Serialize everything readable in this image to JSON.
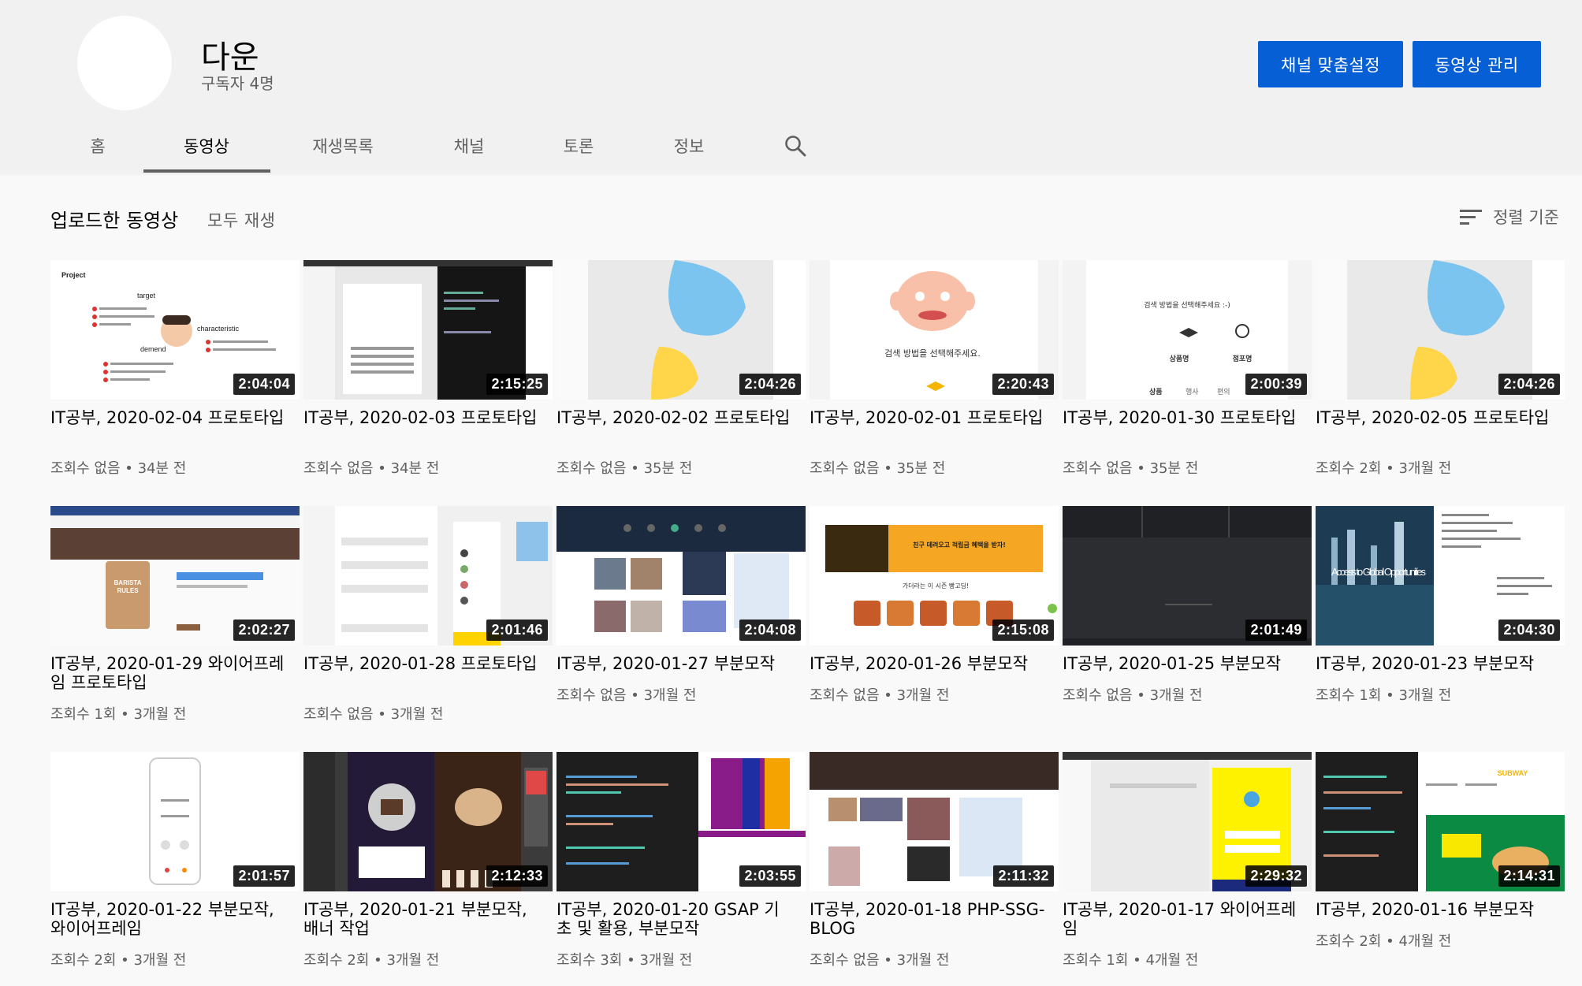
{
  "channel": {
    "name": "다운",
    "subscribers": "구독자 4명",
    "customize_label": "채널 맞춤설정",
    "manage_label": "동영상 관리"
  },
  "tabs": [
    {
      "label": "홈"
    },
    {
      "label": "동영상"
    },
    {
      "label": "재생목록"
    },
    {
      "label": "채널"
    },
    {
      "label": "토론"
    },
    {
      "label": "정보"
    }
  ],
  "section": {
    "title": "업로드한 동영상",
    "play_all": "모두 재생",
    "sort_label": "정렬 기준"
  },
  "videos": [
    {
      "title": "IT공부, 2020-02-04 프로토타입",
      "meta": "조회수 없음 • 34분 전",
      "duration": "2:04:04"
    },
    {
      "title": "IT공부, 2020-02-03 프로토타입",
      "meta": "조회수 없음 • 34분 전",
      "duration": "2:15:25"
    },
    {
      "title": "IT공부, 2020-02-02 프로토타입",
      "meta": "조회수 없음 • 35분 전",
      "duration": "2:04:26"
    },
    {
      "title": "IT공부, 2020-02-01 프로토타입",
      "meta": "조회수 없음 • 35분 전",
      "duration": "2:20:43"
    },
    {
      "title": "IT공부, 2020-01-30 프로토타입",
      "meta": "조회수 없음 • 35분 전",
      "duration": "2:00:39"
    },
    {
      "title": "IT공부, 2020-02-05 프로토타입",
      "meta": "조회수 2회 • 3개월 전",
      "duration": "2:04:26"
    },
    {
      "title": "IT공부, 2020-01-29 와이어프레임 프로토타입",
      "meta": "조회수 1회 • 3개월 전",
      "duration": "2:02:27"
    },
    {
      "title": "IT공부, 2020-01-28 프로토타입",
      "meta": "조회수 없음 • 3개월 전",
      "duration": "2:01:46"
    },
    {
      "title": "IT공부, 2020-01-27 부분모작",
      "meta": "조회수 없음 • 3개월 전",
      "duration": "2:04:08"
    },
    {
      "title": "IT공부, 2020-01-26 부분모작",
      "meta": "조회수 없음 • 3개월 전",
      "duration": "2:15:08"
    },
    {
      "title": "IT공부, 2020-01-25 부분모작",
      "meta": "조회수 없음 • 3개월 전",
      "duration": "2:01:49"
    },
    {
      "title": "IT공부, 2020-01-23 부분모작",
      "meta": "조회수 1회 • 3개월 전",
      "duration": "2:04:30"
    },
    {
      "title": "IT공부, 2020-01-22 부분모작, 와이어프레임",
      "meta": "조회수 2회 • 3개월 전",
      "duration": "2:01:57"
    },
    {
      "title": "IT공부, 2020-01-21 부분모작, 배너 작업",
      "meta": "조회수 2회 • 3개월 전",
      "duration": "2:12:33"
    },
    {
      "title": "IT공부, 2020-01-20 GSAP 기초 및 활용, 부분모작",
      "meta": "조회수 3회 • 3개월 전",
      "duration": "2:03:55"
    },
    {
      "title": "IT공부, 2020-01-18 PHP-SSG-BLOG",
      "meta": "조회수 없음 • 3개월 전",
      "duration": "2:11:32"
    },
    {
      "title": "IT공부, 2020-01-17 와이어프레임",
      "meta": "조회수 1회 • 4개월 전",
      "duration": "2:29:32"
    },
    {
      "title": "IT공부, 2020-01-16 부분모작",
      "meta": "조회수 2회 • 4개월 전",
      "duration": "2:14:31"
    }
  ],
  "thumb_text": {
    "t0_project": "Project",
    "t0_target": "target",
    "t0_characteristic": "characteristic",
    "t0_demend": "demend",
    "t3_caption": "검색 방법을 선택해주세요.",
    "t4_caption": "검색 방법을 선택해주세요 :-)",
    "t4_opt1": "상품명",
    "t4_opt2": "점포명",
    "t4_nav1": "상품",
    "t4_nav2": "행사",
    "t4_nav3": "편의",
    "t6_cup1": "BARISTA",
    "t6_cup2": "RULES",
    "t9_banner": "친구 데려오고 적립금 혜택을 받자!",
    "t9_sub": "가더라는 이 시즌 빵고딩!",
    "t11_headline": "Access to Global Opportunities",
    "t17_brand": "SUBWAY"
  },
  "colors": {
    "accent": "#065fd4",
    "text_secondary": "#606060",
    "header_bg": "#f1f1f1",
    "page_bg": "#f9f9f9"
  }
}
